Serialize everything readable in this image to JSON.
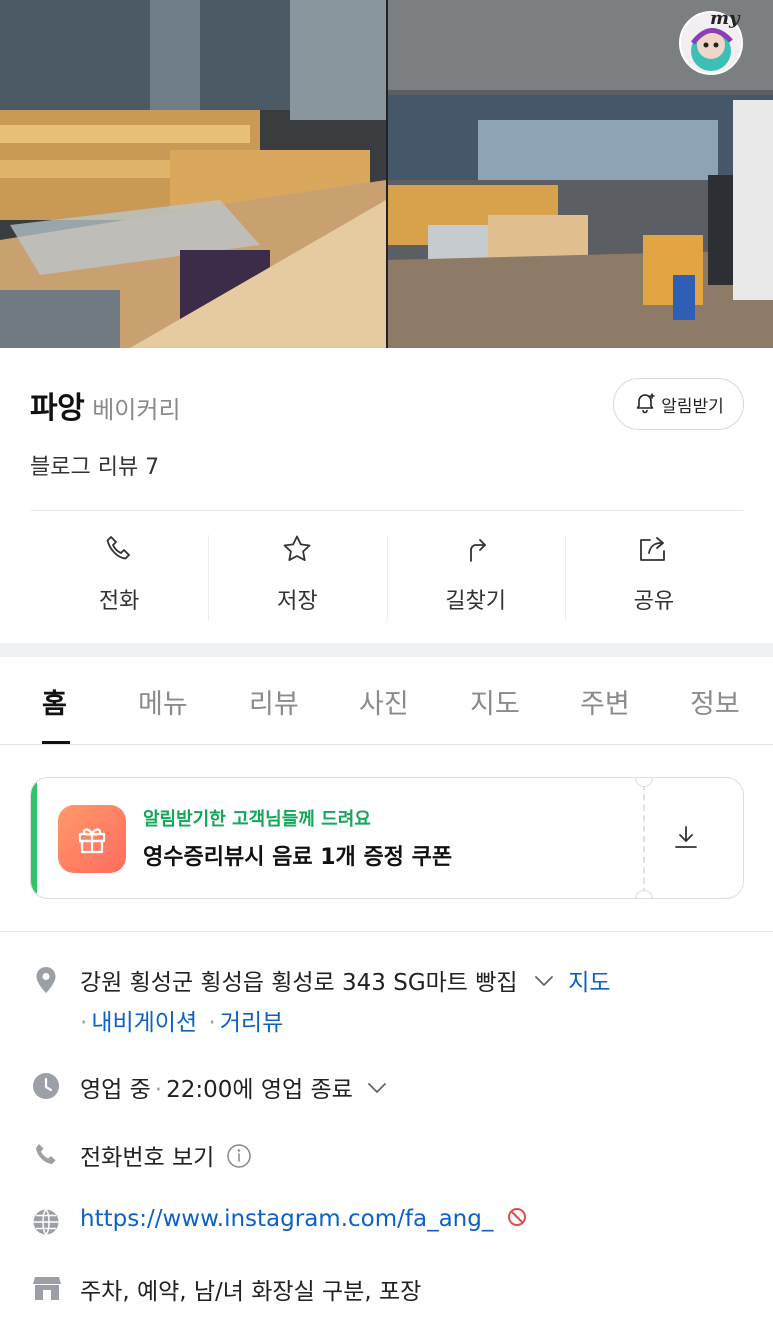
{
  "place": {
    "name": "파앙",
    "category": "베이커리",
    "review_label": "블로그 리뷰 7",
    "alarm_label": "알림받기",
    "avatar_text": "my"
  },
  "actions": [
    {
      "label": "전화",
      "icon": "phone-icon"
    },
    {
      "label": "저장",
      "icon": "star-icon"
    },
    {
      "label": "길찾기",
      "icon": "directions-arrow-icon"
    },
    {
      "label": "공유",
      "icon": "share-icon"
    }
  ],
  "tabs": [
    "홈",
    "메뉴",
    "리뷰",
    "사진",
    "지도",
    "주변",
    "정보"
  ],
  "coupon": {
    "subtitle": "알림받기한 고객님들께 드려요",
    "title": "영수증리뷰시 음료 1개 증정 쿠폰"
  },
  "info": {
    "address": "강원 횡성군 횡성읍 횡성로 343 SG마트 빵집",
    "map_link": "지도",
    "navigation_link": "내비게이션",
    "streetview_link": "거리뷰",
    "status": "영업 중",
    "hours": "22:00에 영업 종료",
    "phone_label": "전화번호 보기",
    "website": "https://www.instagram.com/fa_ang_",
    "amenities": "주차, 예약, 남/녀 화장실 구분, 포장"
  },
  "colors": {
    "accent_green": "#2ec46a",
    "link_blue": "#0b62c4",
    "coupon_icon": "#ff7a62"
  }
}
